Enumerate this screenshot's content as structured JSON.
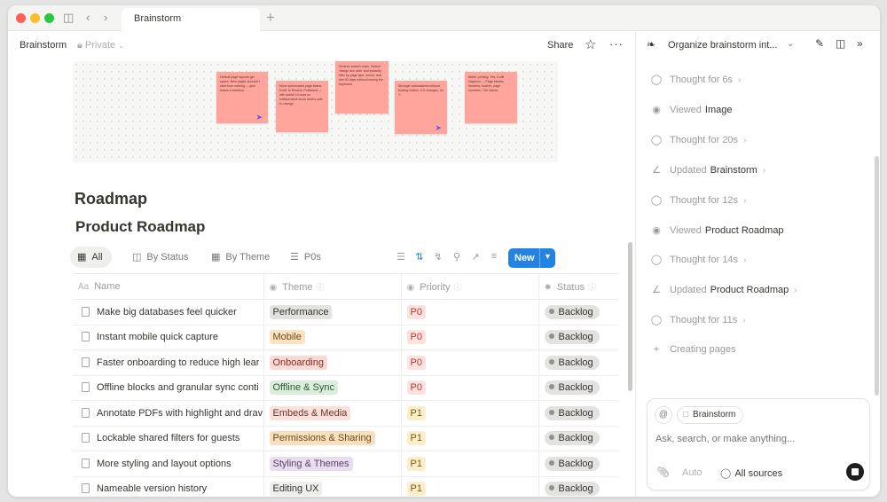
{
  "browser": {
    "tab_title": "Brainstorm"
  },
  "page": {
    "breadcrumb": "Brainstorm",
    "privacy": "Private",
    "share_label": "Share",
    "heading": "Roadmap",
    "db_title": "Product Roadmap"
  },
  "whiteboard": {
    "notes": [
      "Default page layouts get space. New pages shouldn't start from nothing — give teams a skeleton.",
      "More opinionated page status. Draft, In Review, Published — with subtle UI cues so collaborators know what's safe to change.",
      "Smarter search chips. Search 'design doc auth' and instantly filter by page type, owner, and last 90 days without leaving the keyboard.",
      "Stronger automations without leaving Notion. If X changes, do Y.",
      "Better printing. Yes, it still happens — Page breaks, headers, footers, page numbers. The basics."
    ]
  },
  "views": {
    "tabs": [
      {
        "label": "All",
        "icon": "table-icon"
      },
      {
        "label": "By Status",
        "icon": "board-icon"
      },
      {
        "label": "By Theme",
        "icon": "table-icon"
      },
      {
        "label": "P0s",
        "icon": "list-icon"
      }
    ],
    "new_label": "New"
  },
  "table": {
    "headers": {
      "name": "Name",
      "theme": "Theme",
      "priority": "Priority",
      "status": "Status"
    },
    "rows": [
      {
        "name": "Make big databases feel quicker",
        "theme": "Performance",
        "theme_color": "#e3e2e0",
        "theme_text": "#37352f",
        "priority": "P0",
        "status": "Backlog"
      },
      {
        "name": "Instant mobile quick capture",
        "theme": "Mobile",
        "theme_color": "#fae3c4",
        "theme_text": "#6e4a14",
        "priority": "P0",
        "status": "Backlog"
      },
      {
        "name": "Faster onboarding to reduce high lear",
        "theme": "Onboarding",
        "theme_color": "#fbd9d5",
        "theme_text": "#8a2a20",
        "priority": "P0",
        "status": "Backlog"
      },
      {
        "name": "Offline blocks and granular sync conti",
        "theme": "Offline & Sync",
        "theme_color": "#dbeddb",
        "theme_text": "#2b5a34",
        "priority": "P0",
        "status": "Backlog"
      },
      {
        "name": "Annotate PDFs with highlight and drav",
        "theme": "Embeds & Media",
        "theme_color": "#fbe1db",
        "theme_text": "#6b3328",
        "priority": "P1",
        "status": "Backlog"
      },
      {
        "name": "Lockable shared filters for guests",
        "theme": "Permissions & Sharing",
        "theme_color": "#f8dfc0",
        "theme_text": "#6e4a14",
        "priority": "P1",
        "status": "Backlog"
      },
      {
        "name": "More styling and layout options",
        "theme": "Styling & Themes",
        "theme_color": "#e8deee",
        "theme_text": "#5a3e73",
        "priority": "P1",
        "status": "Backlog"
      },
      {
        "name": "Nameable version history",
        "theme": "Editing UX",
        "theme_color": "#eeeeec",
        "theme_text": "#37352f",
        "priority": "P1",
        "status": "Backlog"
      }
    ],
    "priority_colors": {
      "P0": "#fde1de",
      "P1": "#fbeecb"
    },
    "priority_text": {
      "P0": "#b23a2f",
      "P1": "#7a5a10"
    }
  },
  "ai_panel": {
    "title": "Organize brainstorm int...",
    "activity": [
      {
        "icon": "bulb-icon",
        "text": "Thought for 6s",
        "bold": "",
        "chevron": true
      },
      {
        "icon": "eye-icon",
        "text": "Viewed",
        "bold": "Image",
        "chevron": false
      },
      {
        "icon": "bulb-icon",
        "text": "Thought for 20s",
        "bold": "",
        "chevron": true
      },
      {
        "icon": "pencil-icon",
        "text": "Updated",
        "bold": "Brainstorm",
        "chevron": true
      },
      {
        "icon": "bulb-icon",
        "text": "Thought for 12s",
        "bold": "",
        "chevron": true
      },
      {
        "icon": "eye-icon",
        "text": "Viewed",
        "bold": "Product Roadmap",
        "chevron": false
      },
      {
        "icon": "bulb-icon",
        "text": "Thought for 14s",
        "bold": "",
        "chevron": true
      },
      {
        "icon": "pencil-icon",
        "text": "Updated",
        "bold": "Product Roadmap",
        "chevron": true
      },
      {
        "icon": "bulb-icon",
        "text": "Thought for 11s",
        "bold": "",
        "chevron": true
      },
      {
        "icon": "plus-icon",
        "text": "Creating pages",
        "bold": "",
        "chevron": false
      }
    ],
    "composer": {
      "context_chip": "Brainstorm",
      "placeholder": "Ask, search, or make anything...",
      "mode": "Auto",
      "sources": "All sources"
    }
  }
}
